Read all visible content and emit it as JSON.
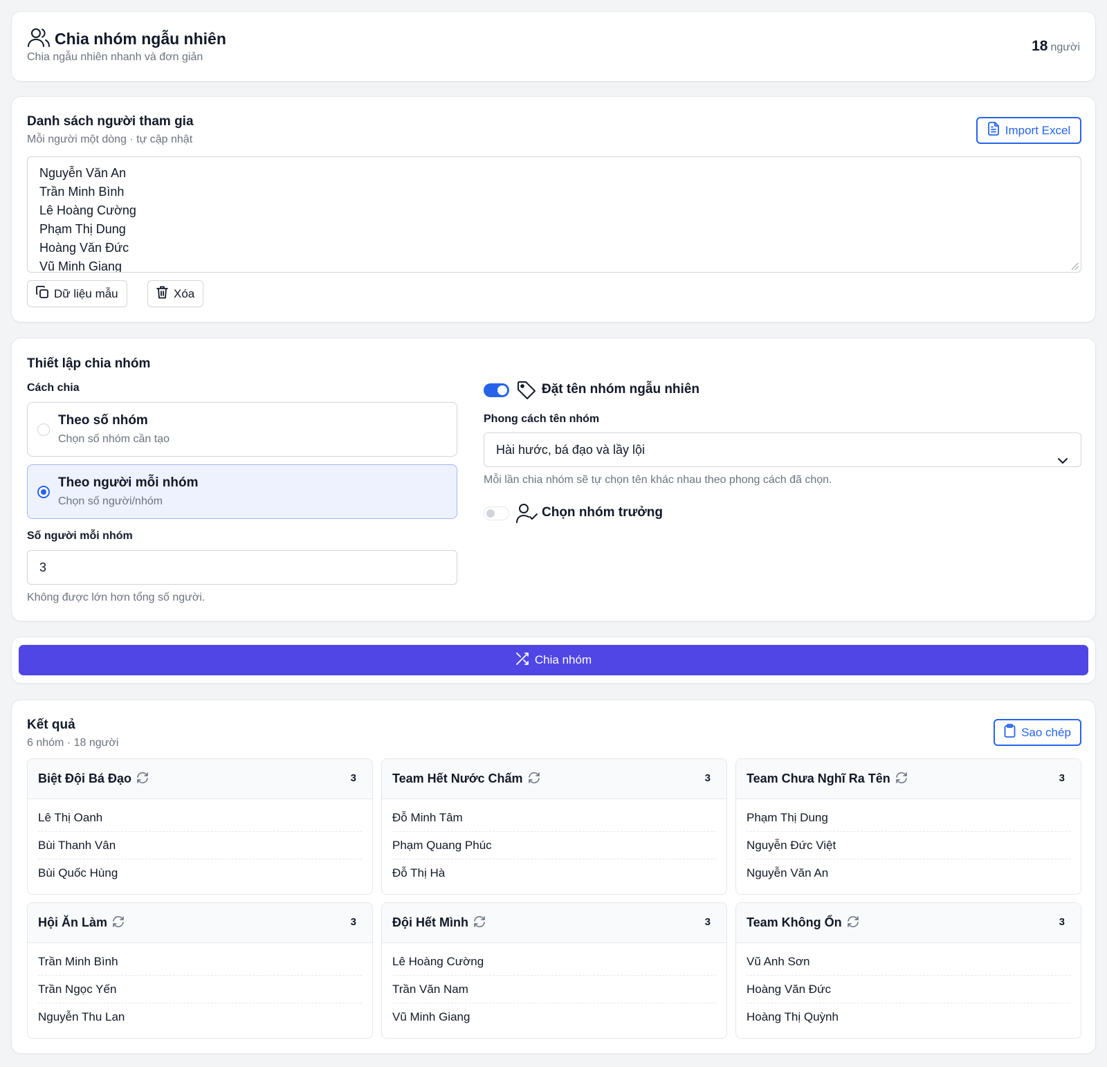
{
  "header": {
    "title": "Chia nhóm ngẫu nhiên",
    "subtitle": "Chia ngẫu nhiên nhanh và đơn giản",
    "count": "18",
    "count_unit": "người"
  },
  "participants": {
    "title": "Danh sách người tham gia",
    "subtitle": "Mỗi người một dòng · tự cập nhật",
    "import_label": "Import Excel",
    "names": [
      "Nguyễn Văn An",
      "Trần Minh Bình",
      "Lê Hoàng Cường",
      "Phạm Thị Dung",
      "Hoàng Văn Đức",
      "Vũ Minh Giang"
    ],
    "sample_label": "Dữ liệu mẫu",
    "clear_label": "Xóa"
  },
  "settings": {
    "title": "Thiết lập chia nhóm",
    "method_label": "Cách chia",
    "options": [
      {
        "title": "Theo số nhóm",
        "sub": "Chọn số nhóm cần tạo",
        "selected": false
      },
      {
        "title": "Theo người mỗi nhóm",
        "sub": "Chọn số người/nhóm",
        "selected": true
      }
    ],
    "per_group_label": "Số người mỗi nhóm",
    "per_group_value": "3",
    "per_group_hint": "Không được lớn hơn tổng số người.",
    "random_name_label": "Đặt tên nhóm ngẫu nhiên",
    "random_name_on": true,
    "style_label": "Phong cách tên nhóm",
    "style_value": "Hài hước, bá đạo và lầy lội",
    "style_hint": "Mỗi lần chia nhóm sẽ tự chọn tên khác nhau theo phong cách đã chọn.",
    "leader_label": "Chọn nhóm trưởng",
    "leader_on": false
  },
  "split_button_label": "Chia nhóm",
  "results": {
    "title": "Kết quả",
    "summary": "6 nhóm · 18 người",
    "copy_label": "Sao chép",
    "groups": [
      {
        "name": "Biệt Đội Bá Đạo",
        "count": "3",
        "members": [
          "Lê Thị Oanh",
          "Bùi Thanh Vân",
          "Bùi Quốc Hùng"
        ]
      },
      {
        "name": "Team Hết Nước Chấm",
        "count": "3",
        "members": [
          "Đỗ Minh Tâm",
          "Phạm Quang Phúc",
          "Đỗ Thị Hà"
        ]
      },
      {
        "name": "Team Chưa Nghĩ Ra Tên",
        "count": "3",
        "members": [
          "Phạm Thị Dung",
          "Nguyễn Đức Việt",
          "Nguyễn Văn An"
        ]
      },
      {
        "name": "Hội Ăn Làm",
        "count": "3",
        "members": [
          "Trần Minh Bình",
          "Trần Ngọc Yến",
          "Nguyễn Thu Lan"
        ]
      },
      {
        "name": "Đội Hết Mình",
        "count": "3",
        "members": [
          "Lê Hoàng Cường",
          "Trần Văn Nam",
          "Vũ Minh Giang"
        ]
      },
      {
        "name": "Team Không Ổn",
        "count": "3",
        "members": [
          "Vũ Anh Sơn",
          "Hoàng Văn Đức",
          "Hoàng Thị Quỳnh"
        ]
      }
    ]
  },
  "colors": {
    "primary": "#4f46e5",
    "accent_blue": "#2563eb",
    "selected_bg": "#eef2ff"
  }
}
